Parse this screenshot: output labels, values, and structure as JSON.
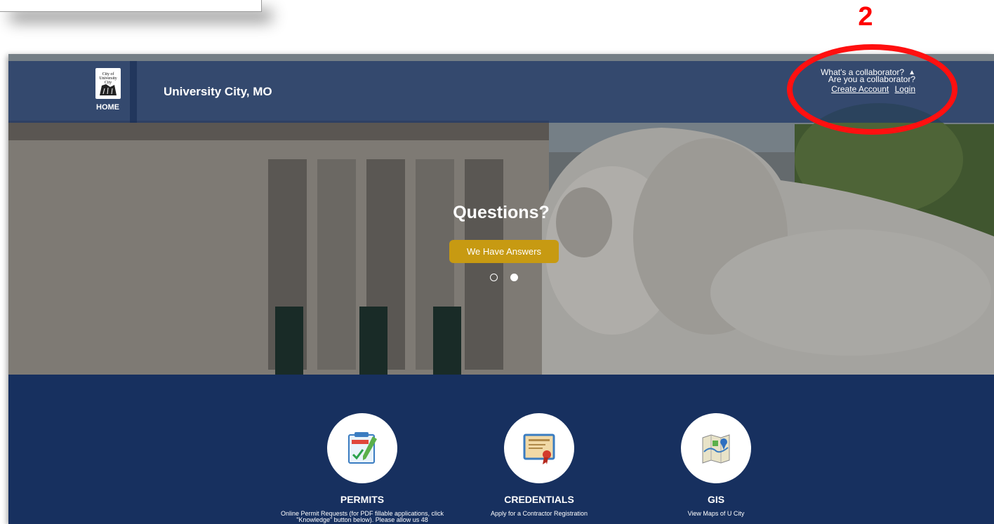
{
  "annotation": {
    "step_number": "2"
  },
  "header": {
    "home_label": "HOME",
    "logo_text": "City of University City",
    "site_title": "University City, MO",
    "collaborator": {
      "question": "Are you a collaborator?",
      "create_account": "Create Account",
      "login": "Login",
      "whats": "What's a collaborator?"
    }
  },
  "hero": {
    "headline": "Questions?",
    "button_label": "We Have Answers",
    "slides": 2,
    "active_slide": 2
  },
  "services": [
    {
      "icon": "permit-icon",
      "title": "PERMITS",
      "desc": "Online Permit Requests (for PDF fillable applications, click \"Knowledge\" button below). Please allow us 48"
    },
    {
      "icon": "credential-certificate-icon",
      "title": "CREDENTIALS",
      "desc": "Apply for a Contractor Registration"
    },
    {
      "icon": "map-icon",
      "title": "GIS",
      "desc": "View Maps of U City"
    }
  ],
  "colors": {
    "accent_button": "#c79a12",
    "navy": "#17305f",
    "annotation_red": "#ff0000"
  }
}
